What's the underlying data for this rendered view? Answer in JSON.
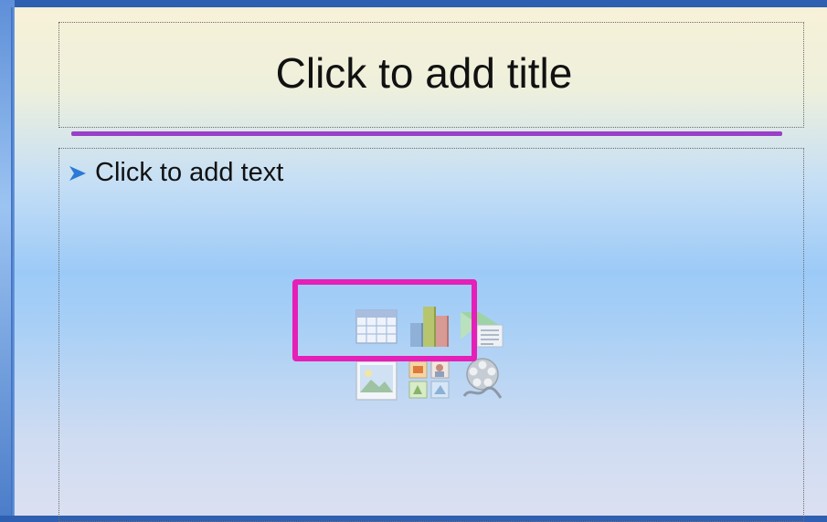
{
  "slide": {
    "title_placeholder": "Click to add title",
    "body_placeholder": "Click to add text"
  },
  "content_icons": [
    {
      "name": "insert-table-icon",
      "row": 1
    },
    {
      "name": "insert-chart-icon",
      "row": 1
    },
    {
      "name": "insert-smartart-icon",
      "row": 1
    },
    {
      "name": "insert-picture-icon",
      "row": 2
    },
    {
      "name": "insert-clip-art-icon",
      "row": 2
    },
    {
      "name": "insert-media-clip-icon",
      "row": 2
    }
  ],
  "colors": {
    "title_rule": "#9a3fc8",
    "highlight_border": "#e51fb7",
    "bullet_arrow": "#2a7ad6"
  }
}
